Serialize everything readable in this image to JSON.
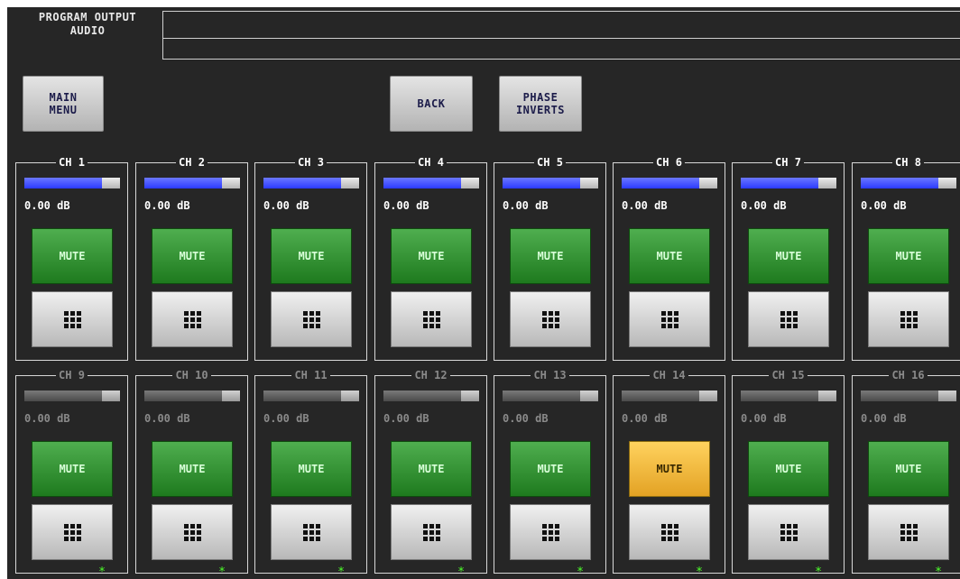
{
  "header": {
    "title": "PROGRAM OUTPUT\nAUDIO"
  },
  "buttons": {
    "main_menu": "MAIN\nMENU",
    "back": "BACK",
    "phase_inverts": "PHASE\nINVERTS"
  },
  "mute_label": "MUTE",
  "colors": {
    "background": "#262626",
    "meter_blue": "#3a47ff",
    "mute_green": "#2f8f2f",
    "mute_active": "#f2b840",
    "star_green": "#4dff2a",
    "active_text": "#ffffff",
    "inactive_text": "#8a8a8a"
  },
  "icons": {
    "keypad": "keypad-icon",
    "star": "star-icon"
  },
  "channels": [
    {
      "label": "CH 1",
      "level": "0.00 dB",
      "meter_fill": 0.81,
      "active": true,
      "muted": false
    },
    {
      "label": "CH 2",
      "level": "0.00 dB",
      "meter_fill": 0.81,
      "active": true,
      "muted": false
    },
    {
      "label": "CH 3",
      "level": "0.00 dB",
      "meter_fill": 0.81,
      "active": true,
      "muted": false
    },
    {
      "label": "CH 4",
      "level": "0.00 dB",
      "meter_fill": 0.81,
      "active": true,
      "muted": false
    },
    {
      "label": "CH 5",
      "level": "0.00 dB",
      "meter_fill": 0.81,
      "active": true,
      "muted": false
    },
    {
      "label": "CH 6",
      "level": "0.00 dB",
      "meter_fill": 0.81,
      "active": true,
      "muted": false
    },
    {
      "label": "CH 7",
      "level": "0.00 dB",
      "meter_fill": 0.81,
      "active": true,
      "muted": false
    },
    {
      "label": "CH 8",
      "level": "0.00 dB",
      "meter_fill": 0.81,
      "active": true,
      "muted": false
    },
    {
      "label": "CH 9",
      "level": "0.00 dB",
      "meter_fill": 0.81,
      "active": false,
      "muted": false
    },
    {
      "label": "CH 10",
      "level": "0.00 dB",
      "meter_fill": 0.81,
      "active": false,
      "muted": false
    },
    {
      "label": "CH 11",
      "level": "0.00 dB",
      "meter_fill": 0.81,
      "active": false,
      "muted": false
    },
    {
      "label": "CH 12",
      "level": "0.00 dB",
      "meter_fill": 0.81,
      "active": false,
      "muted": false
    },
    {
      "label": "CH 13",
      "level": "0.00 dB",
      "meter_fill": 0.81,
      "active": false,
      "muted": false
    },
    {
      "label": "CH 14",
      "level": "0.00 dB",
      "meter_fill": 0.81,
      "active": false,
      "muted": true
    },
    {
      "label": "CH 15",
      "level": "0.00 dB",
      "meter_fill": 0.81,
      "active": false,
      "muted": false
    },
    {
      "label": "CH 16",
      "level": "0.00 dB",
      "meter_fill": 0.81,
      "active": false,
      "muted": false
    }
  ],
  "status_stars": [
    "*",
    "*",
    "*",
    "*",
    "*",
    "*",
    "*",
    "*"
  ]
}
